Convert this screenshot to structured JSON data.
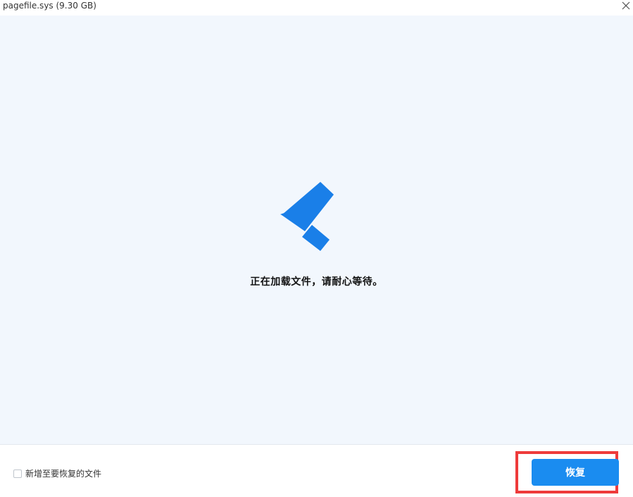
{
  "window": {
    "title": "pagefile.sys (9.30 GB)",
    "close_icon": "close-icon"
  },
  "preview": {
    "loading_icon": "loading-logo-icon",
    "loading_message": "正在加载文件，请耐心等待。",
    "colors": {
      "background": "#f2f7fd",
      "logo": "#1a7fe8"
    }
  },
  "footer": {
    "checkbox": {
      "label": "新增至要恢复的文件",
      "checked": false
    },
    "recover_button": {
      "label": "恢复"
    },
    "colors": {
      "button": "#1a8cf0",
      "highlight": "#ee3b3b"
    }
  }
}
